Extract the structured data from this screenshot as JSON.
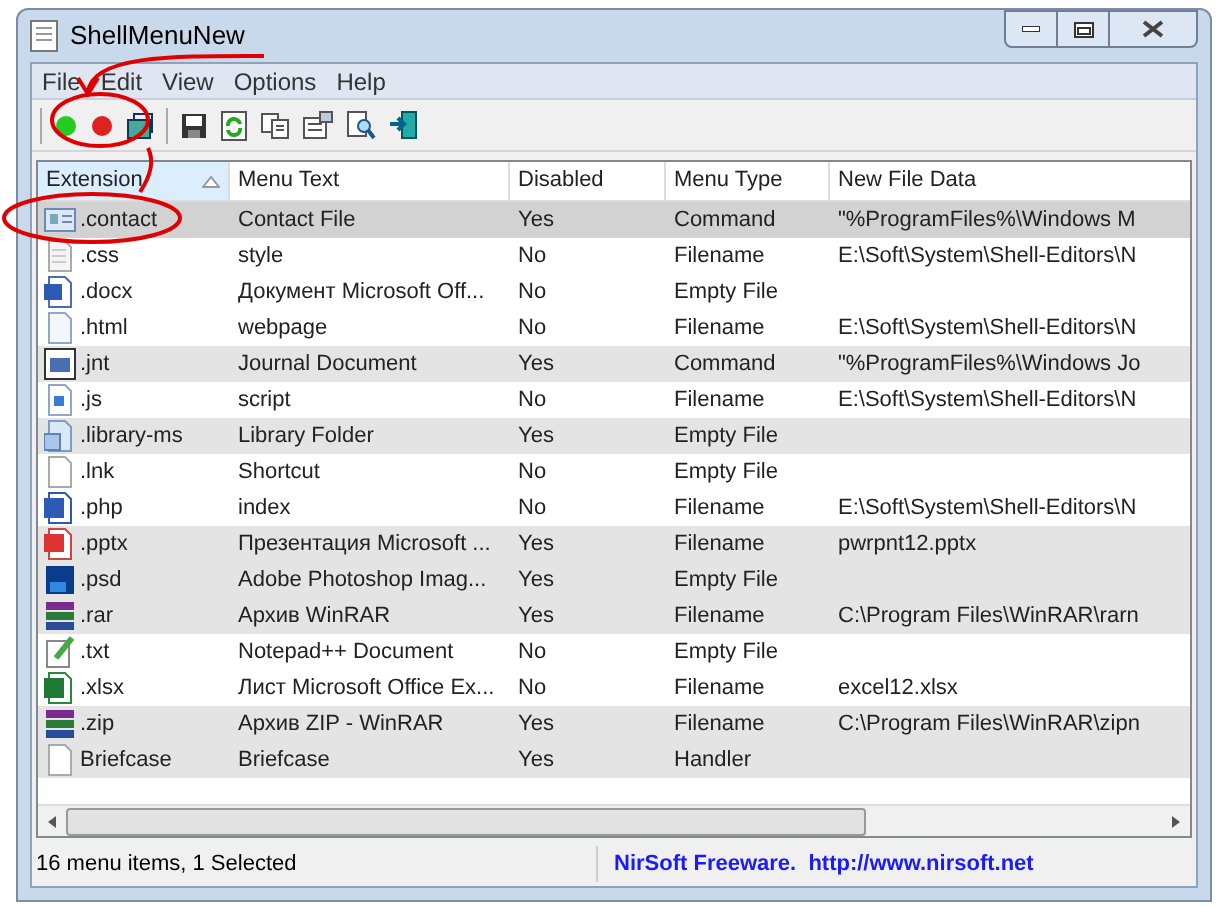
{
  "window": {
    "title": "ShellMenuNew"
  },
  "menu": [
    "File",
    "Edit",
    "View",
    "Options",
    "Help"
  ],
  "table": {
    "columns": [
      {
        "label": "Extension",
        "sorted": true
      },
      {
        "label": "Menu Text",
        "sorted": false
      },
      {
        "label": "Disabled",
        "sorted": false
      },
      {
        "label": "Menu Type",
        "sorted": false
      },
      {
        "label": "New File Data",
        "sorted": false
      }
    ],
    "rows": [
      {
        "cells": [
          ".contact",
          "Contact File",
          "Yes",
          "Command",
          "\"%ProgramFiles%\\Windows M"
        ],
        "disabled": true,
        "selected": true
      },
      {
        "cells": [
          ".css",
          "style",
          "No",
          "Filename",
          "E:\\Soft\\System\\Shell-Editors\\N"
        ],
        "disabled": false,
        "selected": false
      },
      {
        "cells": [
          ".docx",
          "Документ Microsoft Off...",
          "No",
          "Empty File",
          ""
        ],
        "disabled": false,
        "selected": false
      },
      {
        "cells": [
          ".html",
          "webpage",
          "No",
          "Filename",
          "E:\\Soft\\System\\Shell-Editors\\N"
        ],
        "disabled": false,
        "selected": false
      },
      {
        "cells": [
          ".jnt",
          "Journal Document",
          "Yes",
          "Command",
          "\"%ProgramFiles%\\Windows Jo"
        ],
        "disabled": true,
        "selected": false
      },
      {
        "cells": [
          ".js",
          "script",
          "No",
          "Filename",
          "E:\\Soft\\System\\Shell-Editors\\N"
        ],
        "disabled": false,
        "selected": false
      },
      {
        "cells": [
          ".library-ms",
          "Library Folder",
          "Yes",
          "Empty File",
          ""
        ],
        "disabled": true,
        "selected": false
      },
      {
        "cells": [
          ".lnk",
          "Shortcut",
          "No",
          "Empty File",
          ""
        ],
        "disabled": false,
        "selected": false
      },
      {
        "cells": [
          ".php",
          "index",
          "No",
          "Filename",
          "E:\\Soft\\System\\Shell-Editors\\N"
        ],
        "disabled": false,
        "selected": false
      },
      {
        "cells": [
          ".pptx",
          "Презентация Microsoft ...",
          "Yes",
          "Filename",
          "pwrpnt12.pptx"
        ],
        "disabled": true,
        "selected": false
      },
      {
        "cells": [
          ".psd",
          "Adobe Photoshop Imag...",
          "Yes",
          "Empty File",
          ""
        ],
        "disabled": true,
        "selected": false
      },
      {
        "cells": [
          ".rar",
          "Архив WinRAR",
          "Yes",
          "Filename",
          "C:\\Program Files\\WinRAR\\rarn"
        ],
        "disabled": true,
        "selected": false
      },
      {
        "cells": [
          ".txt",
          "Notepad++ Document",
          "No",
          "Empty File",
          ""
        ],
        "disabled": false,
        "selected": false
      },
      {
        "cells": [
          ".xlsx",
          "Лист Microsoft Office Ex...",
          "No",
          "Filename",
          "excel12.xlsx"
        ],
        "disabled": false,
        "selected": false
      },
      {
        "cells": [
          ".zip",
          "Архив ZIP - WinRAR",
          "Yes",
          "Filename",
          "C:\\Program Files\\WinRAR\\zipn"
        ],
        "disabled": true,
        "selected": false
      },
      {
        "cells": [
          "Briefcase",
          "Briefcase",
          "Yes",
          "Handler",
          ""
        ],
        "disabled": true,
        "selected": false
      }
    ]
  },
  "status_bar": {
    "count": "16 menu items, 1 Selected",
    "credit": "NirSoft Freeware.  http://www.nirsoft.net"
  }
}
